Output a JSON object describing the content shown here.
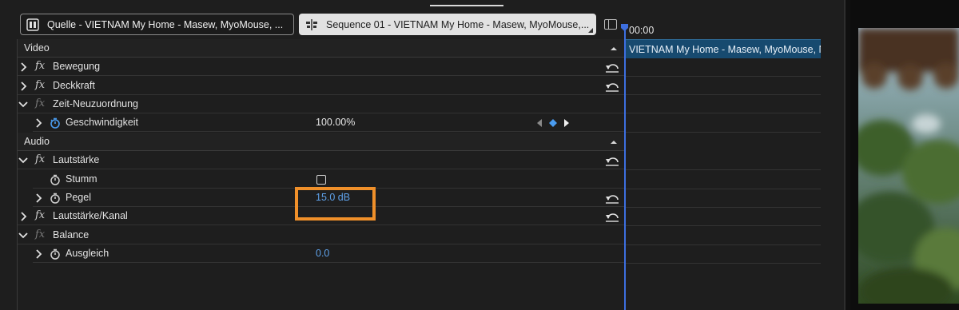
{
  "tabs": {
    "source": {
      "label": "Quelle - VIETNAM   My Home - Masew, MyoMouse, ..."
    },
    "sequence": {
      "label": "Sequence 01 - VIETNAM   My Home - Masew, MyoMouse,..."
    }
  },
  "sections": {
    "video": "Video",
    "audio": "Audio"
  },
  "effects": {
    "bewegung": "Bewegung",
    "deckkraft": "Deckkraft",
    "zeit": "Zeit-Neuzuordnung",
    "geschwindigkeit": {
      "label": "Geschwindigkeit",
      "value": "100.00%"
    },
    "lautstaerke": "Lautstärke",
    "stumm": {
      "label": "Stumm",
      "checked": false
    },
    "pegel": {
      "label": "Pegel",
      "value": "15.0 dB"
    },
    "lautstaerke_kanal": "Lautstärke/Kanal",
    "balance": "Balance",
    "ausgleich": {
      "label": "Ausgleich",
      "value": "0.0"
    }
  },
  "timeline": {
    "timecode": "00:00",
    "clip_label": "VIETNAM   My Home - Masew, MyoMouse, N"
  },
  "colors": {
    "accent_blue": "#5fa2ea",
    "highlight": "#f0902a",
    "clip": "#174a6f"
  },
  "icons": {
    "keyframe_prev": "triangle-left-icon",
    "keyframe_add": "diamond-icon",
    "keyframe_next": "triangle-right-icon",
    "reset": "reset-arrow-icon",
    "stopwatch": "stopwatch-icon"
  }
}
